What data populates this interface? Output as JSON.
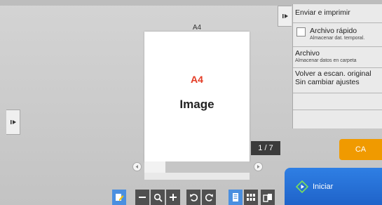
{
  "preview": {
    "paper_label": "A4",
    "page_title": "A4",
    "page_image_text": "Image",
    "page_counter": "1 / 7"
  },
  "panel": {
    "send_print": "Enviar e imprimir",
    "quick_file": {
      "label": "Archivo rápido",
      "sub": "Almacenar dat. temporal."
    },
    "file": {
      "label": "Archivo",
      "sub": "Almacenar datos en carpeta"
    },
    "rescan": {
      "line1": "Volver a escan. original",
      "line2": "Sin cambiar ajustes"
    }
  },
  "buttons": {
    "ca": "CA",
    "start": "Iniciar"
  },
  "colors": {
    "page_title": "#e43b24",
    "ca_button": "#f09a00",
    "start_button": "#2f7fe4",
    "toolbar_button": "#505050",
    "toolbar_active": "#4a8fe0"
  },
  "icons": {
    "side_toggle": "play-arrow",
    "panel_collapse": "play-arrow",
    "toolbar": [
      "edit-page",
      "zoom-out",
      "zoom-search",
      "zoom-in",
      "rotate-left",
      "rotate-right",
      "single-page-view",
      "thumbnail-view",
      "multi-page-view"
    ],
    "start": "diamond-start"
  }
}
